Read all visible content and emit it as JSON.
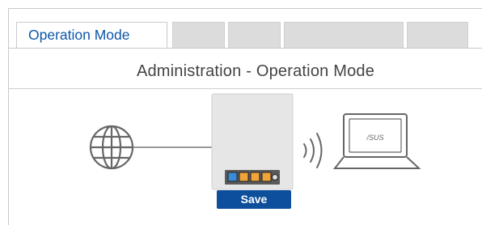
{
  "tabs": [
    {
      "label": "Operation Mode",
      "active": true
    },
    {
      "label": "",
      "active": false
    },
    {
      "label": "",
      "active": false
    },
    {
      "label": "",
      "active": false
    },
    {
      "label": "",
      "active": false
    }
  ],
  "page": {
    "title": "Administration - Operation Mode"
  },
  "diagram": {
    "globe_icon": "globe-icon",
    "router_icon": "router-icon",
    "wireless_icon": "wireless-signal-icon",
    "laptop_icon": "laptop-icon",
    "laptop_brand": "/SUS"
  },
  "actions": {
    "save_label": "Save"
  },
  "colors": {
    "accent": "#0e4f9c",
    "tab_text": "#0d57a8",
    "port_orange": "#f2a33a",
    "port_blue": "#3b8bd6"
  }
}
